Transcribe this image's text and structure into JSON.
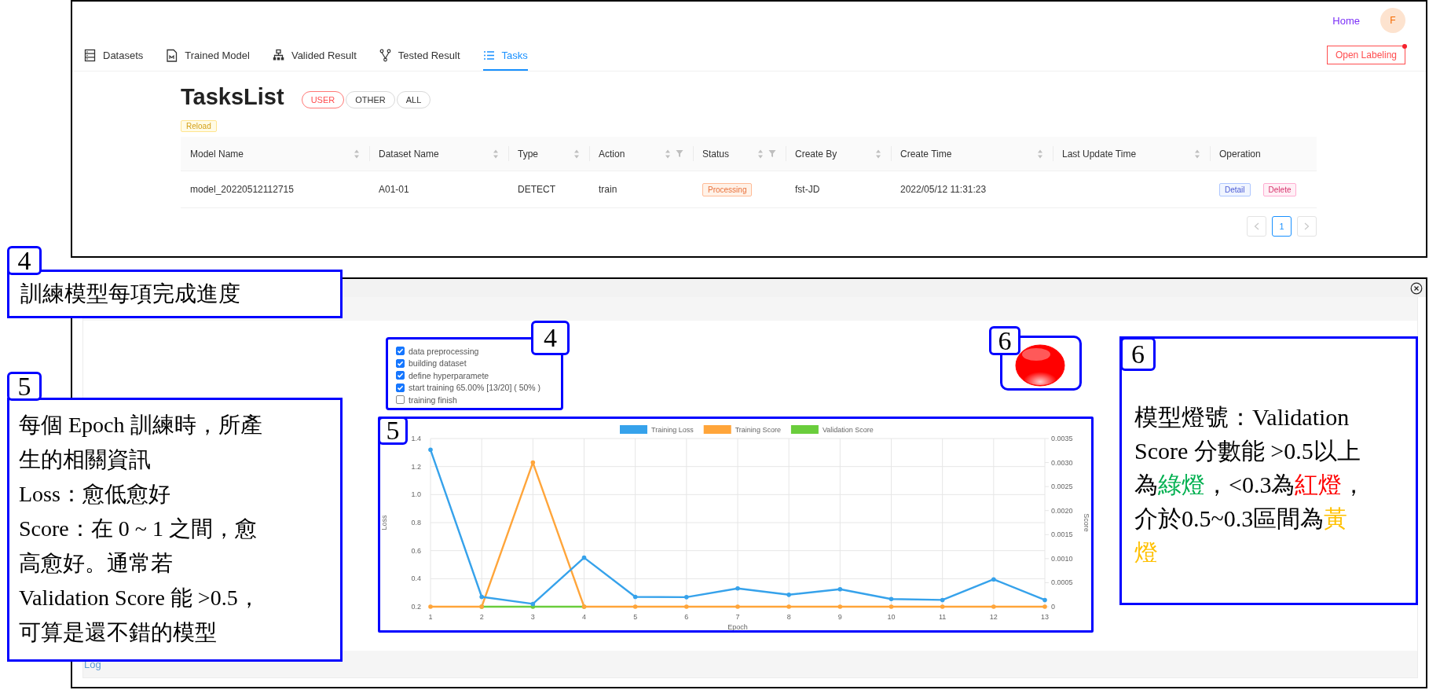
{
  "top_window": {
    "header": {
      "home_link": "Home",
      "avatar": "F"
    },
    "nav_tabs": [
      {
        "label": "Datasets",
        "selected": false
      },
      {
        "label": "Trained Model",
        "selected": false
      },
      {
        "label": "Valided Result",
        "selected": false
      },
      {
        "label": "Tested Result",
        "selected": false
      },
      {
        "label": "Tasks",
        "selected": true
      }
    ],
    "open_labeling": {
      "label": "Open Labeling",
      "notification": true
    },
    "title": "TasksList",
    "filters": [
      {
        "label": "USER",
        "selected": true
      },
      {
        "label": "OTHER",
        "selected": false
      },
      {
        "label": "ALL",
        "selected": false
      }
    ],
    "reload": "Reload",
    "table": {
      "columns": [
        {
          "label": "Model Name",
          "sortable": true,
          "filter": false
        },
        {
          "label": "Dataset Name",
          "sortable": true,
          "filter": false
        },
        {
          "label": "Type",
          "sortable": true,
          "filter": false
        },
        {
          "label": "Action",
          "sortable": true,
          "filter": true
        },
        {
          "label": "Status",
          "sortable": true,
          "filter": true
        },
        {
          "label": "Create By",
          "sortable": true,
          "filter": false
        },
        {
          "label": "Create Time",
          "sortable": true,
          "filter": false
        },
        {
          "label": "Last Update Time",
          "sortable": true,
          "filter": false
        },
        {
          "label": "Operation",
          "sortable": false,
          "filter": false
        }
      ],
      "rows": [
        {
          "cells": [
            {
              "kind": "text",
              "text": "model_20220512112715"
            },
            {
              "kind": "text",
              "text": "A01-01"
            },
            {
              "kind": "text",
              "text": "DETECT"
            },
            {
              "kind": "text",
              "text": "train"
            },
            {
              "kind": "tag",
              "text": "Processing"
            },
            {
              "kind": "text",
              "text": "fst-JD"
            },
            {
              "kind": "text",
              "text": "2022/05/12 11:31:23"
            },
            {
              "kind": "empty"
            },
            {
              "kind": "actions",
              "actions": [
                {
                  "kind": "detail",
                  "label": "Detail"
                },
                {
                  "kind": "delete",
                  "label": "Delete"
                }
              ]
            }
          ]
        }
      ]
    },
    "pagination": [
      {
        "kind": "prev",
        "disabled": true
      },
      {
        "kind": "page",
        "label": "1",
        "selected": true
      },
      {
        "kind": "next",
        "disabled": true
      }
    ]
  },
  "task_detail": {
    "steps": [
      {
        "label": "data preprocessing",
        "checked": true
      },
      {
        "label": "building dataset",
        "checked": true
      },
      {
        "label": "define hyperparamete",
        "checked": true
      },
      {
        "label": "start training 65.00% [13/20] ( 50% )",
        "checked": true
      },
      {
        "label": "training finish",
        "checked": false
      }
    ],
    "status_light": {
      "color": "#ff0000"
    },
    "chart_data": {
      "type": "line",
      "xlabel": "Epoch",
      "ylabel": "Loss",
      "y2label": "Score",
      "categories": [
        "1",
        "2",
        "3",
        "4",
        "5",
        "6",
        "7",
        "8",
        "9",
        "10",
        "11",
        "12",
        "13"
      ],
      "ylim": [
        0.2,
        1.4
      ],
      "yticks": [
        0.2,
        0.4,
        0.6,
        0.8,
        {
          "value": 1,
          "label": "1.0"
        },
        1.2,
        1.4
      ],
      "y2lim": [
        0,
        0.0035
      ],
      "y2ticks": [
        0,
        {
          "value": 0.0005,
          "label": "0.0005"
        },
        {
          "value": 0.001,
          "label": "0.0010"
        },
        {
          "value": 0.0015,
          "label": "0.0015"
        },
        {
          "value": 0.002,
          "label": "0.0020"
        },
        {
          "value": 0.0025,
          "label": "0.0025"
        },
        {
          "value": 0.003,
          "label": "0.0030"
        },
        {
          "value": 0.0035,
          "label": "0.0035"
        }
      ],
      "series": [
        {
          "name": "Training Loss",
          "color": "#36a2eb",
          "values": [
            1.32,
            0.27,
            0.22,
            0.55,
            0.27,
            0.268,
            0.33,
            0.285,
            0.325,
            0.255,
            0.248,
            0.395,
            0.248
          ]
        },
        {
          "name": "Training Score",
          "color": "#ffa53a",
          "axis": "y2",
          "values": [
            0,
            0,
            0.003,
            0,
            0,
            0,
            0,
            0,
            0,
            0,
            0,
            0,
            0
          ]
        },
        {
          "name": "Validation Score",
          "color": "#6acd3c",
          "axis": "y2",
          "values": [
            null,
            0,
            0,
            0,
            null,
            null,
            null,
            null,
            null,
            null,
            null,
            null,
            null
          ]
        }
      ],
      "grid": true,
      "legend": "top"
    },
    "log_label": "Log"
  },
  "annotations": [
    {
      "kind": "note",
      "number": "4",
      "paragraphs": [
        {
          "segments": [
            {
              "text": "訓練模型每項完成進度",
              "color": "#000000"
            }
          ]
        }
      ]
    },
    {
      "kind": "note",
      "number": "5",
      "paragraphs": [
        {
          "segments": [
            {
              "text": "每個 Epoch 訓練時，所產生的相關資訊",
              "color": "#000000"
            }
          ]
        },
        {
          "segments": [
            {
              "text": "Loss：愈低愈好",
              "color": "#000000"
            }
          ]
        },
        {
          "segments": [
            {
              "text": "Score：在 0 ~ 1 之間，愈高愈好。通常若 Validation Score 能 >0.5，可算是還不錯的模型",
              "color": "#000000"
            }
          ]
        }
      ]
    },
    {
      "kind": "note",
      "number": "6",
      "paragraphs": [
        {
          "segments": [
            {
              "text": "模型燈號：Validation Score 分數能 >0.5以上為",
              "color": "#000000"
            },
            {
              "text": "綠燈",
              "color": "#00b050"
            },
            {
              "text": "，<0.3為",
              "color": "#000000"
            },
            {
              "text": "紅燈",
              "color": "#ff0000"
            },
            {
              "text": "，介於0.5~0.3區間為",
              "color": "#000000"
            },
            {
              "text": "黃燈",
              "color": "#ffc000"
            }
          ]
        }
      ]
    },
    {
      "kind": "marker",
      "number": "4"
    },
    {
      "kind": "marker",
      "number": "5"
    },
    {
      "kind": "marker",
      "number": "6"
    }
  ]
}
